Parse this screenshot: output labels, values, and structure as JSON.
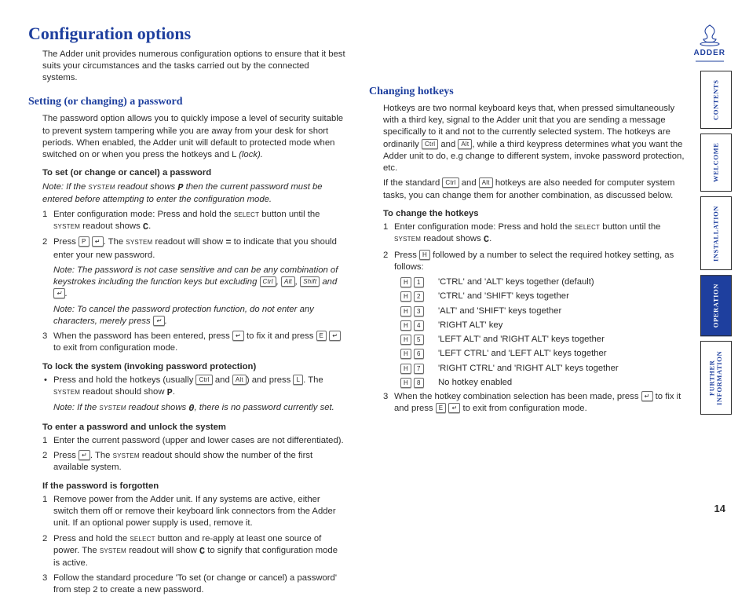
{
  "brand": "ADDER",
  "page_number": "14",
  "title": "Configuration options",
  "intro": "The Adder unit provides numerous configuration options to ensure that it best suits your circumstances and the tasks carried out by the connected systems.",
  "nav": {
    "contents": "CONTENTS",
    "welcome": "WELCOME",
    "installation": "INSTALLATION",
    "operation": "OPERATION",
    "further": "FURTHER\nINFORMATION"
  },
  "left": {
    "h2": "Setting (or changing) a password",
    "p1a": "The password option allows you to quickly impose a level of security suitable to prevent system tampering while you are away from your desk for short periods. When enabled, the Adder unit will default to protected mode when switched on or when you press the hotkeys and L ",
    "p1b": "(lock).",
    "sub1": "To set (or change or cancel) a password",
    "note1a": "Note: If the ",
    "note1b": " readout shows ",
    "note1c": " then the current password must be entered before attempting to enter the configuration mode.",
    "s1a": "Enter configuration mode: Press and hold the ",
    "s1b": " button until the ",
    "s1c": " readout shows ",
    "s2a": "Press ",
    "s2b": ". The ",
    "s2c": " readout will show ",
    "s2d": " to indicate that you should enter your new password.",
    "inote1a": "Note: The password is not case sensitive and can be any combination of keystrokes including the function keys but excluding ",
    "inote1b": " and ",
    "inote2": "Note: To cancel the password protection function, do not enter any characters, merely press ",
    "s3a": "When the password has been entered, press ",
    "s3b": " to fix it and press ",
    "s3c": " to exit from configuration mode.",
    "sub2": "To lock the system (invoking password protection)",
    "bul1a": "Press and hold the hotkeys (usually ",
    "bul1b": " and ",
    "bul1c": ") and press ",
    "bul1d": ". The ",
    "bul1e": " readout should show ",
    "inote3a": "Note: If the ",
    "inote3b": " readout shows ",
    "inote3c": ", there is no password currently set.",
    "sub3": "To enter a password and unlock the system",
    "u1": "Enter the current password (upper and lower cases are not differentiated).",
    "u2a": "Press ",
    "u2b": ". The ",
    "u2c": " readout should show the number of the first available system.",
    "sub4": "If the password is forgotten",
    "f1": "Remove power from the Adder unit. If any systems are active, either switch them off or remove their keyboard link connectors from the Adder unit. If an optional power supply is used, remove it.",
    "f2a": "Press and hold the ",
    "f2b": " button and re-apply at least one source of power. The ",
    "f2c": " readout will show ",
    "f2d": " to signify that configuration mode is active.",
    "f3": "Follow the standard procedure 'To set (or change or cancel) a password' from step 2 to create a new password."
  },
  "right": {
    "h2": "Changing hotkeys",
    "p1a": "Hotkeys are two normal keyboard keys that, when pressed simultaneously with a third key, signal to the Adder unit that you are sending a message specifically to it and not to the currently selected system. The hotkeys are ordinarily ",
    "p1b": " and ",
    "p1c": ", while a third keypress determines what you want the Adder unit to do, e.g change to different system, invoke password protection, etc.",
    "p2a": "If the standard ",
    "p2b": " and ",
    "p2c": " hotkeys are also needed for computer system tasks, you can change them for another combination, as discussed below.",
    "sub1": "To change the hotkeys",
    "s1a": "Enter configuration mode: Press and hold the ",
    "s1b": " button until the ",
    "s1c": " readout shows ",
    "s2a": "Press ",
    "s2b": " followed by a number to select the required hotkey setting, as follows:",
    "hk": [
      {
        "n": "1",
        "label": "'CTRL' and 'ALT' keys together (default)"
      },
      {
        "n": "2",
        "label": "'CTRL' and 'SHIFT' keys together"
      },
      {
        "n": "3",
        "label": "'ALT' and 'SHIFT' keys together"
      },
      {
        "n": "4",
        "label": "'RIGHT ALT' key"
      },
      {
        "n": "5",
        "label": "'LEFT ALT' and 'RIGHT ALT' keys together"
      },
      {
        "n": "6",
        "label": "'LEFT CTRL' and 'LEFT ALT' keys together"
      },
      {
        "n": "7",
        "label": "'RIGHT CTRL' and 'RIGHT ALT' keys together"
      },
      {
        "n": "8",
        "label": "No hotkey enabled"
      }
    ],
    "s3a": "When the hotkey combination selection has been made, press ",
    "s3b": " to fix it and press ",
    "s3c": " to exit from configuration mode."
  },
  "keys": {
    "ctrl": "Ctrl",
    "alt": "Alt",
    "shift": "Shift",
    "enter": "↵",
    "p": "P",
    "e": "E",
    "l": "L",
    "h": "H"
  },
  "sc": {
    "system": "system",
    "select": "select"
  },
  "seg": {
    "C": "C",
    "P": "P",
    "eq": "=",
    "O": "0"
  }
}
